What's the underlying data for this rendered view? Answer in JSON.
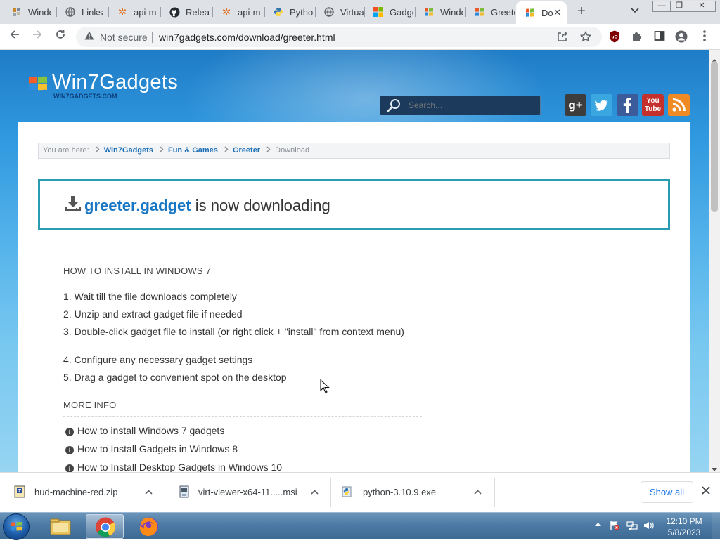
{
  "browser": {
    "tabs": [
      {
        "title": "Windows",
        "icon": "win7gadgets-favicon"
      },
      {
        "title": "Links",
        "icon": "globe-icon"
      },
      {
        "title": "api-m",
        "icon": "gear-favicon"
      },
      {
        "title": "Releases",
        "icon": "github-icon"
      },
      {
        "title": "api-m",
        "icon": "gear-favicon"
      },
      {
        "title": "Python",
        "icon": "python-icon"
      },
      {
        "title": "Virtual",
        "icon": "globe-icon"
      },
      {
        "title": "Gadgets",
        "icon": "windows-logo-icon"
      },
      {
        "title": "Windows",
        "icon": "win7-flag-icon"
      },
      {
        "title": "Greeter",
        "icon": "win7-flag-icon"
      },
      {
        "title": "Do",
        "icon": "win7-flag-icon",
        "active": true
      }
    ],
    "new_tab_symbol": "+",
    "security_label": "Not secure",
    "url": "win7gadgets.com/download/greeter.html",
    "window_controls": {
      "minimize": "—",
      "restore": "❐",
      "close": "✕"
    }
  },
  "site": {
    "logo_text": "Win7Gadgets",
    "logo_subtext": "WIN7GADGETS.COM",
    "search_placeholder": "Search...",
    "social": [
      {
        "name": "google-plus",
        "label": "g+",
        "color": "#3d3d3d"
      },
      {
        "name": "twitter",
        "label": "t",
        "color": "#3aa7e0"
      },
      {
        "name": "facebook",
        "label": "f",
        "color": "#3b5b9a"
      },
      {
        "name": "youtube",
        "label": "You Tube",
        "color": "#c4302b"
      },
      {
        "name": "rss",
        "label": "rss",
        "color": "#f08a24"
      }
    ],
    "breadcrumb": {
      "prefix": "You are here:",
      "items": [
        "Win7Gadgets",
        "Fun & Games",
        "Greeter"
      ],
      "current": "Download"
    },
    "download": {
      "filename": "greeter.gadget",
      "status_text": " is now downloading"
    },
    "install_heading": "HOW TO INSTALL IN WINDOWS 7",
    "install_steps": [
      "1. Wait till the file downloads completely",
      "2. Unzip and extract gadget file if needed",
      "3. Double-click gadget file to install (or right click + \"install\" from context menu)",
      "4. Configure any necessary gadget settings",
      "5. Drag a gadget to convenient spot on the desktop"
    ],
    "more_heading": "MORE INFO",
    "more_links": [
      "How to install Windows 7 gadgets",
      "How to Install Gadgets in Windows 8",
      "How to Install Desktop Gadgets in Windows 10"
    ]
  },
  "downloads_shelf": {
    "items": [
      {
        "name": "hud-machine-red.zip",
        "icon": "zip-file-icon"
      },
      {
        "name": "virt-viewer-x64-11.....msi",
        "icon": "msi-file-icon"
      },
      {
        "name": "python-3.10.9.exe",
        "icon": "python-installer-icon"
      }
    ],
    "show_all_label": "Show all"
  },
  "taskbar": {
    "apps": [
      "file-explorer",
      "chrome",
      "firefox"
    ],
    "clock_time": "12:10 PM",
    "clock_date": "5/8/2023"
  }
}
